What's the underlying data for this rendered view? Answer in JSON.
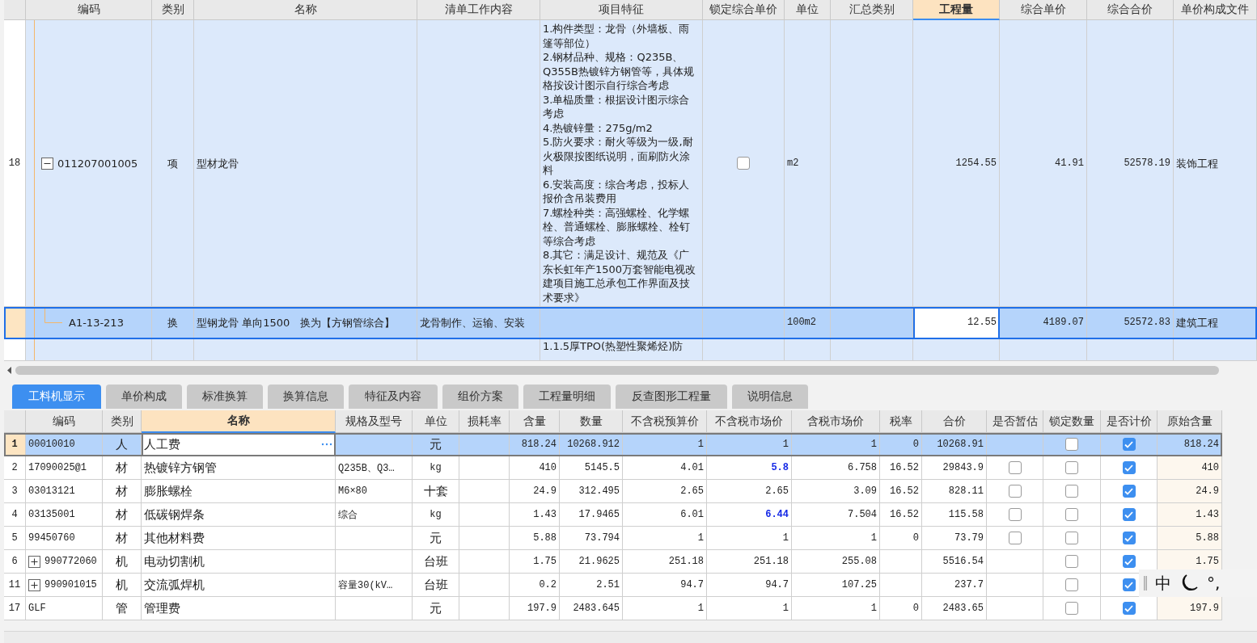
{
  "top_table": {
    "columns": [
      {
        "selected": false
      },
      {
        "label": "编码",
        "selected": false
      },
      {
        "label": "类别",
        "selected": false
      },
      {
        "label": "名称",
        "selected": false
      },
      {
        "label": "清单工作内容",
        "selected": false
      },
      {
        "label": "项目特征",
        "selected": false
      },
      {
        "label": "锁定综合单价",
        "selected": false
      },
      {
        "label": "单位",
        "selected": false
      },
      {
        "label": "汇总类别",
        "selected": false
      },
      {
        "label": "工程量",
        "selected": true
      },
      {
        "label": "综合单价",
        "selected": false
      },
      {
        "label": "综合合价",
        "selected": false
      },
      {
        "label": "单价构成文件",
        "selected": false
      }
    ],
    "rows": [
      {
        "kind": "item",
        "selected": false,
        "row_number": "18",
        "expanded": true,
        "code": "011207001005",
        "type": "项",
        "name": "型材龙骨",
        "work_content": "",
        "features": "1.构件类型：龙骨（外墙板、雨篷等部位）\n2.钢材品种、规格：Q235B、Q355B热镀锌方钢管等，具体规格按设计图示自行综合考虑\n3.单榀质量：根据设计图示综合考虑\n4.热镀锌量：275g/m2\n5.防火要求：耐火等级为一级,耐火极限按图纸说明，面刷防火涂料\n6.安装高度：综合考虑，投标人报价含吊装费用\n7.螺栓种类：高强螺栓、化学螺栓、普通螺栓、膨胀螺栓、栓钉等综合考虑\n8.其它：满足设计、规范及《广东长虹年产1500万套智能电视改建项目施工总承包工作界面及技术要求》",
        "lock_price": false,
        "unit": "m2",
        "summary_category": "",
        "quantity": "1254.55",
        "unit_price": "41.91",
        "total": "52578.19",
        "price_file": "装饰工程"
      },
      {
        "kind": "sub",
        "selected": true,
        "row_number": "",
        "code": "A1-13-213",
        "type": "换",
        "name": "型钢龙骨 单向1500　换为【方钢管综合】",
        "work_content": "龙骨制作、运输、安装",
        "features": "",
        "unit": "100m2",
        "summary_category": "",
        "quantity": "12.55",
        "unit_price": "4189.07",
        "total": "52572.83",
        "price_file": "建筑工程"
      },
      {
        "kind": "partial",
        "selected": false,
        "row_number": "",
        "code": "",
        "type": "",
        "name": "",
        "work_content": "",
        "features": "1.1.5厚TPO(热塑性聚烯烃)防",
        "unit": "",
        "summary_category": "",
        "quantity": "",
        "unit_price": "",
        "total": "",
        "price_file": ""
      }
    ]
  },
  "tabs": [
    {
      "label": "工料机显示",
      "selected": true
    },
    {
      "label": "单价构成",
      "selected": false
    },
    {
      "label": "标准换算",
      "selected": false
    },
    {
      "label": "换算信息",
      "selected": false
    },
    {
      "label": "特征及内容",
      "selected": false
    },
    {
      "label": "组价方案",
      "selected": false
    },
    {
      "label": "工程量明细",
      "selected": false
    },
    {
      "label": "反查图形工程量",
      "selected": false
    },
    {
      "label": "说明信息",
      "selected": false
    }
  ],
  "resource_table": {
    "columns": [
      {
        "selected": false
      },
      {
        "label": "编码",
        "selected": false
      },
      {
        "label": "类别",
        "selected": false
      },
      {
        "label": "名称",
        "selected": true
      },
      {
        "label": "规格及型号",
        "selected": false
      },
      {
        "label": "单位",
        "selected": false
      },
      {
        "label": "损耗率",
        "selected": false
      },
      {
        "label": "含量",
        "selected": false
      },
      {
        "label": "数量",
        "selected": false
      },
      {
        "label": "不含税预算价",
        "selected": false
      },
      {
        "label": "不含税市场价",
        "selected": false
      },
      {
        "label": "含税市场价",
        "selected": false
      },
      {
        "label": "税率",
        "selected": false
      },
      {
        "label": "合价",
        "selected": false
      },
      {
        "label": "是否暂估",
        "selected": false
      },
      {
        "label": "锁定数量",
        "selected": false
      },
      {
        "label": "是否计价",
        "selected": false
      },
      {
        "label": "原始含量",
        "selected": false
      }
    ],
    "rows": [
      {
        "row_number": "1",
        "selected": true,
        "expandable": false,
        "code": "00010010",
        "type": "人",
        "name": "人工费",
        "spec": "",
        "unit": "元",
        "content": "818.24",
        "quantity": "10268.912",
        "budget_price": "1",
        "market_price": "1",
        "market_price_modified": false,
        "tax_price": "1",
        "tax_rate": "0",
        "total": "10268.91",
        "lock_qty": false,
        "priced": true,
        "original_content": "818.24"
      },
      {
        "row_number": "2",
        "selected": false,
        "expandable": false,
        "code": "17090025@1",
        "type": "材",
        "name": "热镀锌方钢管",
        "spec": "Q235B、Q3…",
        "unit": "kg",
        "content": "410",
        "quantity": "5145.5",
        "budget_price": "4.01",
        "market_price": "5.8",
        "market_price_modified": true,
        "tax_price": "6.758",
        "tax_rate": "16.52",
        "total": "29843.9",
        "provisional": false,
        "lock_qty": false,
        "priced": true,
        "original_content": "410"
      },
      {
        "row_number": "3",
        "selected": false,
        "expandable": false,
        "code": "03013121",
        "type": "材",
        "name": "膨胀螺栓",
        "spec": "M6×80",
        "unit": "十套",
        "content": "24.9",
        "quantity": "312.495",
        "budget_price": "2.65",
        "market_price": "2.65",
        "market_price_modified": false,
        "tax_price": "3.09",
        "tax_rate": "16.52",
        "total": "828.11",
        "provisional": false,
        "lock_qty": false,
        "priced": true,
        "original_content": "24.9"
      },
      {
        "row_number": "4",
        "selected": false,
        "expandable": false,
        "code": "03135001",
        "type": "材",
        "name": "低碳钢焊条",
        "spec": "综合",
        "unit": "kg",
        "content": "1.43",
        "quantity": "17.9465",
        "budget_price": "6.01",
        "market_price": "6.44",
        "market_price_modified": true,
        "tax_price": "7.504",
        "tax_rate": "16.52",
        "total": "115.58",
        "provisional": false,
        "lock_qty": false,
        "priced": true,
        "original_content": "1.43"
      },
      {
        "row_number": "5",
        "selected": false,
        "expandable": false,
        "code": "99450760",
        "type": "材",
        "name": "其他材料费",
        "spec": "",
        "unit": "元",
        "content": "5.88",
        "quantity": "73.794",
        "budget_price": "1",
        "market_price": "1",
        "market_price_modified": false,
        "tax_price": "1",
        "tax_rate": "0",
        "total": "73.79",
        "provisional": false,
        "lock_qty": false,
        "priced": true,
        "original_content": "5.88"
      },
      {
        "row_number": "6",
        "selected": false,
        "expandable": true,
        "code": "990772060",
        "type": "机",
        "name": "电动切割机",
        "spec": "",
        "unit": "台班",
        "content": "1.75",
        "quantity": "21.9625",
        "budget_price": "251.18",
        "market_price": "251.18",
        "market_price_modified": false,
        "tax_price": "255.08",
        "tax_rate": "",
        "total": "5516.54",
        "lock_qty": false,
        "priced": true,
        "original_content": "1.75"
      },
      {
        "row_number": "11",
        "selected": false,
        "expandable": true,
        "code": "990901015",
        "type": "机",
        "name": "交流弧焊机",
        "spec": "容量30(kV…",
        "unit": "台班",
        "content": "0.2",
        "quantity": "2.51",
        "budget_price": "94.7",
        "market_price": "94.7",
        "market_price_modified": false,
        "tax_price": "107.25",
        "tax_rate": "",
        "total": "237.7",
        "lock_qty": false,
        "priced": true,
        "original_content": ""
      },
      {
        "row_number": "17",
        "selected": false,
        "expandable": false,
        "code": "GLF",
        "type": "管",
        "name": "管理费",
        "spec": "",
        "unit": "元",
        "content": "197.9",
        "quantity": "2483.645",
        "budget_price": "1",
        "market_price": "1",
        "market_price_modified": false,
        "tax_price": "1",
        "tax_rate": "0",
        "total": "2483.65",
        "lock_qty": false,
        "priced": true,
        "original_content": "197.9"
      }
    ]
  },
  "ime": {
    "mode": "中",
    "punctuation": "°,"
  }
}
